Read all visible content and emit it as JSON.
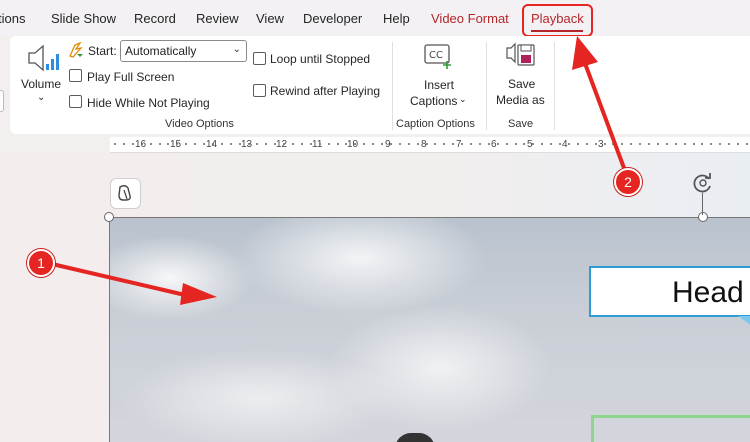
{
  "tabs": [
    {
      "label": "tions"
    },
    {
      "label": "Slide Show"
    },
    {
      "label": "Record"
    },
    {
      "label": "Review"
    },
    {
      "label": "View"
    },
    {
      "label": "Developer"
    },
    {
      "label": "Help"
    },
    {
      "label": "Video Format"
    },
    {
      "label": "Playback"
    }
  ],
  "ribbon": {
    "volume": {
      "label": "Volume",
      "icon": "speaker-volume-icon"
    },
    "start": {
      "label": "Start:",
      "value": "Automatically"
    },
    "checks": {
      "play_full_screen": "Play Full Screen",
      "hide_while_not_playing": "Hide While Not Playing",
      "loop_until_stopped": "Loop until Stopped",
      "rewind_after_playing": "Rewind after Playing"
    },
    "video_options_label": "Video Options",
    "insert_captions": {
      "line1": "Insert",
      "line2": "Captions",
      "icon": "cc-icon"
    },
    "caption_options_label": "Caption Options",
    "save_media": {
      "line1": "Save",
      "line2": "Media as",
      "icon": "save-media-icon"
    },
    "save_label": "Save"
  },
  "ruler": {
    "labels": [
      "16",
      "15",
      "14",
      "13",
      "12",
      "11",
      "10",
      "9",
      "8",
      "7",
      "6",
      "5",
      "4",
      "3"
    ]
  },
  "slide": {
    "headline": "Head"
  },
  "annotations": {
    "marker1": "1",
    "marker2": "2",
    "color": "#e52521"
  },
  "colors": {
    "accent": "#b4262b",
    "highlight": "#e52521"
  }
}
